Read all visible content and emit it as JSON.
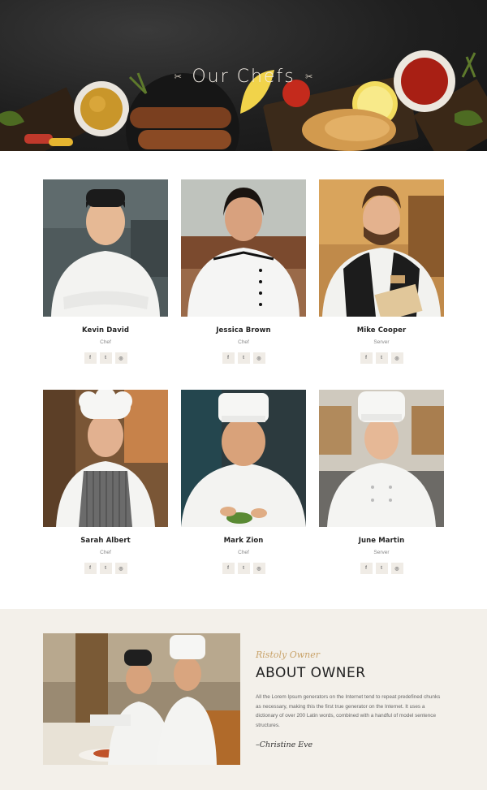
{
  "hero": {
    "title": "Our Chefs",
    "ornament_left": "✂",
    "ornament_right": "✂"
  },
  "chefs": [
    {
      "name": "Kevin David",
      "role": "Chef",
      "socials": [
        "f",
        "t",
        "◎"
      ]
    },
    {
      "name": "Jessica Brown",
      "role": "Chef",
      "socials": [
        "f",
        "t",
        "◎"
      ]
    },
    {
      "name": "Mike Cooper",
      "role": "Server",
      "socials": [
        "f",
        "t",
        "◎"
      ]
    },
    {
      "name": "Sarah Albert",
      "role": "Chef",
      "socials": [
        "f",
        "t",
        "◎"
      ]
    },
    {
      "name": "Mark Zion",
      "role": "Chef",
      "socials": [
        "f",
        "t",
        "◎"
      ]
    },
    {
      "name": "June Martin",
      "role": "Server",
      "socials": [
        "f",
        "t",
        "◎"
      ]
    }
  ],
  "social_icons": [
    "facebook-icon",
    "twitter-icon",
    "instagram-icon"
  ],
  "owner": {
    "script_label": "Ristoly Owner",
    "heading": "ABOUT OWNER",
    "paragraph": "All the Lorem Ipsum generators on the Internet tend to repeat predefined chunks as necessary, making this the first true generator on the Internet. It uses a dictionary of over 200 Latin words, combined with a handful of model sentence structures.",
    "signature": "–Christine Eve"
  },
  "colors": {
    "accent": "#c9a36a",
    "hero_bg": "#1f1f1f",
    "owner_bg": "#f3f0ea",
    "social_bg": "#f0ece6"
  }
}
